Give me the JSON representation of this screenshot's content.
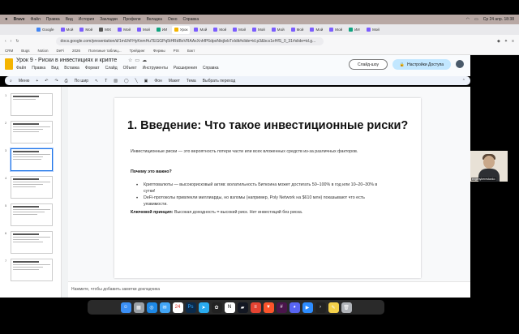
{
  "menubar": {
    "apple": "",
    "brand": "Brave",
    "items": [
      "Файл",
      "Правка",
      "Вид",
      "История",
      "Закладки",
      "Профили",
      "Вкладка",
      "Окно",
      "Справка"
    ],
    "clock": "Ср 24 апр. 18:38"
  },
  "browser": {
    "url": "docs.google.com/presentation/d/1mUhFHyKnmHuTEGGPq5tHRdBoVRAAxXnhfP6dpoNtxjIebTxIdit#slide=id.p3&bcs1eHfS_0_31#slide=id.g...",
    "tabs": [
      "Google",
      "Мой",
      "Мой",
      "MIX",
      "Мой",
      "Мой",
      "ИИ",
      "Урок",
      "Мой",
      "Мой",
      "Мой",
      "Мой",
      "Мой",
      "Мой",
      "Мой",
      "Мой",
      "Мой",
      "ИИ",
      "Мой",
      "ИИ",
      "Мой",
      "Мой",
      "Мой",
      "Мой",
      "Мой"
    ],
    "bookmarks": [
      "CRM",
      "Bugs",
      "Notion",
      "DeFi",
      "2026",
      "Полезные таблиц...",
      "Трейдинг",
      "Фермы",
      "PIX",
      "Бэкт"
    ]
  },
  "doc": {
    "title": "Урок 9 - Риски в инвестициях и крипте",
    "menus": [
      "Файл",
      "Правка",
      "Вид",
      "Вставка",
      "Формат",
      "Слайд",
      "Объект",
      "Инструменты",
      "Расширения",
      "Справка"
    ],
    "slideshow_label": "Слайд-шоу",
    "share_label": "Настройки Доступа"
  },
  "toolbar": {
    "menu_label": "Меню",
    "zoom_label": "По шир",
    "background_label": "Фон",
    "layout_label": "Макет",
    "theme_label": "Тема",
    "transition_label": "Выбрать переход"
  },
  "filmstrip": {
    "numbers": [
      "1",
      "2",
      "3",
      "4",
      "5",
      "6",
      "7"
    ],
    "selected": "3"
  },
  "slide": {
    "title": "1. Введение: Что такое инвестиционные риски?",
    "intro": "Инвестиционные риски — это вероятность потери части или всех вложенных средств из-за различных факторов.",
    "why_heading": "Почему это важно?",
    "bullets": [
      "Криптовалюты — высокорисковый актив: волатильность Биткоина может достигать 50–100% в год или 10–20–30% в сутки!",
      "DeFi-протоколы привлекли миллиарды, но взломы (например, Poly Network на $610 млн) показывают что есть уязвимости."
    ],
    "principle_label": "Ключевой принцип:",
    "principle_text": "Высокая доходность = высокий риск. Нет инвестиций без риска."
  },
  "notes": {
    "placeholder": "Нажмите, чтобы добавить заметки докладчика"
  },
  "webcam": {
    "name": "evgenyberestanko"
  },
  "dock": {
    "icons": [
      "finder-icon",
      "launchpad-icon",
      "safari-icon",
      "mail-icon",
      "calendar-icon",
      "photoshop-icon",
      "telegram-icon",
      "chatgpt-icon",
      "notion-icon",
      "tradingview-icon",
      "todoist-icon",
      "brave-icon",
      "slack-icon",
      "discord-icon",
      "zoom-icon",
      "terminal-icon",
      "notes-icon",
      "trash-icon"
    ],
    "calendar_day": "24"
  },
  "colors": {
    "accent": "#1a73e8",
    "share_button": "#c2e7ff",
    "slides_logo": "#f4b400"
  }
}
